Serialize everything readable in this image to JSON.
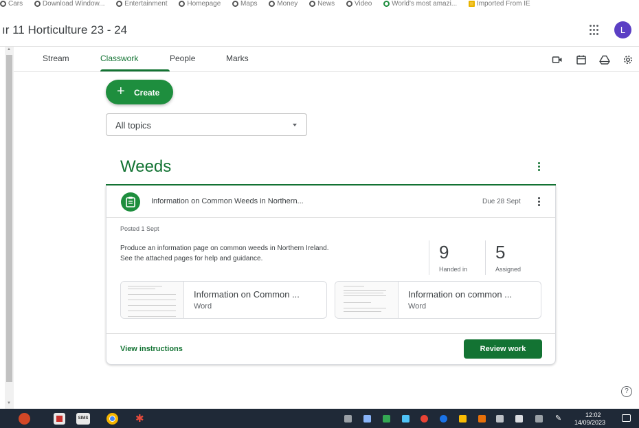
{
  "bookmarks": [
    "Cars",
    "Download Window...",
    "Entertainment",
    "Homepage",
    "Maps",
    "Money",
    "News",
    "Video",
    "World's most amazi...",
    "Imported From IE"
  ],
  "header": {
    "class_title": "ır 11 Horticulture 23 - 24",
    "avatar_letter": "L"
  },
  "tabs": [
    {
      "label": "Stream"
    },
    {
      "label": "Classwork"
    },
    {
      "label": "People"
    },
    {
      "label": "Marks"
    }
  ],
  "toolbar_icons": [
    "video-icon",
    "calendar-icon",
    "drive-icon",
    "settings-icon"
  ],
  "create_button": {
    "label": "Create"
  },
  "topic_filter": {
    "value": "All topics"
  },
  "topic": {
    "title": "Weeds"
  },
  "assignment": {
    "title": "Information on Common Weeds in Northern...",
    "due": "Due 28 Sept",
    "posted": "Posted 1 Sept",
    "description_line1": "Produce an information page on common weeds in Northern Ireland.",
    "description_line2": "See the attached pages for help and guidance.",
    "handed_in_count": "9",
    "handed_in_label": "Handed in",
    "assigned_count": "5",
    "assigned_label": "Assigned",
    "attachments": [
      {
        "name": "Information on Common ...",
        "type": "Word"
      },
      {
        "name": "Information on common ...",
        "type": "Word"
      }
    ],
    "view_instructions": "View instructions",
    "review_button": "Review work"
  },
  "help_symbol": "?",
  "taskbar": {
    "sims_label": "SIMS",
    "time": "12:02",
    "date": "14/09/2023"
  },
  "colors": {
    "accent": "#137333",
    "button": "#1e8e3e",
    "avatar": "#5b3fc4"
  }
}
